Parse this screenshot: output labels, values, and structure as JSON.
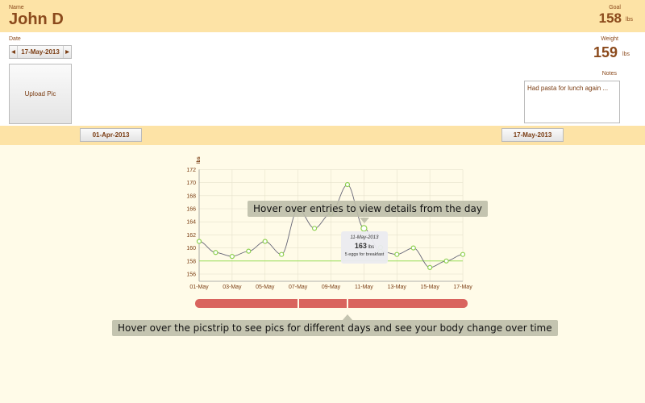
{
  "header": {
    "name_label": "Name",
    "name": "John D",
    "goal_label": "Goal",
    "goal": "158",
    "goal_unit": "lbs"
  },
  "entry": {
    "date_label": "Date",
    "date": "17-May-2013",
    "upload_label": "Upload Pic",
    "weight_label": "Weight",
    "weight": "159",
    "weight_unit": "lbs",
    "notes_label": "Notes",
    "notes": "Had pasta for lunch again ..."
  },
  "range": {
    "start": "01-Apr-2013",
    "end": "17-May-2013"
  },
  "chart_data": {
    "type": "line",
    "ylabel": "lbs",
    "ylim": [
      155.3,
      172
    ],
    "yticks": [
      "156",
      "158",
      "160",
      "162",
      "164",
      "166",
      "168",
      "170",
      "172"
    ],
    "xticks": [
      "01-May",
      "03-May",
      "05-May",
      "07-May",
      "09-May",
      "11-May",
      "13-May",
      "15-May",
      "17-May"
    ],
    "days": [
      1,
      2,
      3,
      4,
      5,
      6,
      7,
      8,
      9,
      10,
      11,
      12,
      13,
      14,
      15,
      16,
      17
    ],
    "values": [
      161,
      159.3,
      158.7,
      159.5,
      161,
      159,
      166,
      163,
      165.3,
      169.7,
      163,
      159.5,
      159,
      160,
      157,
      158,
      159
    ],
    "goal": 158,
    "goal_color": "#9be05a",
    "line_color": "#666677",
    "point_color": "#8fd14f"
  },
  "detail_tip": {
    "date": "11-May-2013",
    "weight": "163",
    "unit": "lbs",
    "note": "5 eggs for breakfast"
  },
  "hints": {
    "chart": "Hover over entries to view details from the day",
    "picstrip": "Hover over the picstrip to see pics for different days and see your body change over time"
  },
  "picstrip_color": "#d9645e"
}
